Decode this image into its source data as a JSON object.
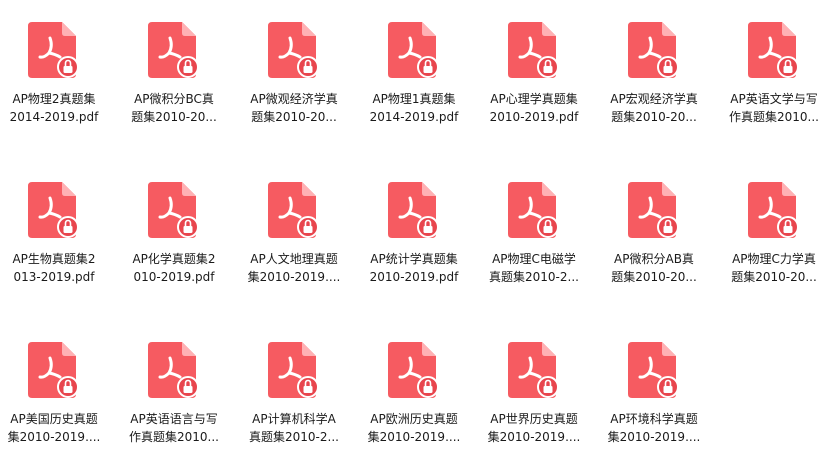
{
  "colors": {
    "icon": "#f65b61",
    "icon_fold": "#ffb1b4",
    "lock_bg": "#e8454d",
    "label": "#1a1a1a"
  },
  "files": [
    {
      "name": "AP物理2真题集2014-2019.pdf",
      "line1": "AP物理2真题集",
      "line2": "2014-2019.pdf"
    },
    {
      "name": "AP微积分BC真题集2010-20...",
      "line1": "AP微积分BC真",
      "line2": "题集2010-20..."
    },
    {
      "name": "AP微观经济学真题集2010-20...",
      "line1": "AP微观经济学真",
      "line2": "题集2010-20..."
    },
    {
      "name": "AP物理1真题集2014-2019.pdf",
      "line1": "AP物理1真题集",
      "line2": "2014-2019.pdf"
    },
    {
      "name": "AP心理学真题集2010-2019.pdf",
      "line1": "AP心理学真题集",
      "line2": "2010-2019.pdf"
    },
    {
      "name": "AP宏观经济学真题集2010-20...",
      "line1": "AP宏观经济学真",
      "line2": "题集2010-20..."
    },
    {
      "name": "AP英语文学与写作真题集2010...",
      "line1": "AP英语文学与写",
      "line2": "作真题集2010..."
    },
    {
      "name": "AP生物真题集2013-2019.pdf",
      "line1": "AP生物真题集2",
      "line2": "013-2019.pdf"
    },
    {
      "name": "AP化学真题集2010-2019.pdf",
      "line1": "AP化学真题集2",
      "line2": "010-2019.pdf"
    },
    {
      "name": "AP人文地理真题集2010-2019....",
      "line1": "AP人文地理真题",
      "line2": "集2010-2019...."
    },
    {
      "name": "AP统计学真题集2010-2019.pdf",
      "line1": "AP统计学真题集",
      "line2": "2010-2019.pdf"
    },
    {
      "name": "AP物理C电磁学真题集2010-2...",
      "line1": "AP物理C电磁学",
      "line2": "真题集2010-2..."
    },
    {
      "name": "AP微积分AB真题集2010-20...",
      "line1": "AP微积分AB真",
      "line2": "题集2010-20..."
    },
    {
      "name": "AP物理C力学真题集2010-20...",
      "line1": "AP物理C力学真",
      "line2": "题集2010-20..."
    },
    {
      "name": "AP美国历史真题集2010-2019....",
      "line1": "AP美国历史真题",
      "line2": "集2010-2019...."
    },
    {
      "name": "AP英语语言与写作真题集2010...",
      "line1": "AP英语语言与写",
      "line2": "作真题集2010..."
    },
    {
      "name": "AP计算机科学A真题集2010-2...",
      "line1": "AP计算机科学A",
      "line2": "真题集2010-2..."
    },
    {
      "name": "AP欧洲历史真题集2010-2019....",
      "line1": "AP欧洲历史真题",
      "line2": "集2010-2019...."
    },
    {
      "name": "AP世界历史真题集2010-2019....",
      "line1": "AP世界历史真题",
      "line2": "集2010-2019...."
    },
    {
      "name": "AP环境科学真题集2010-2019....",
      "line1": "AP环境科学真题",
      "line2": "集2010-2019...."
    }
  ]
}
